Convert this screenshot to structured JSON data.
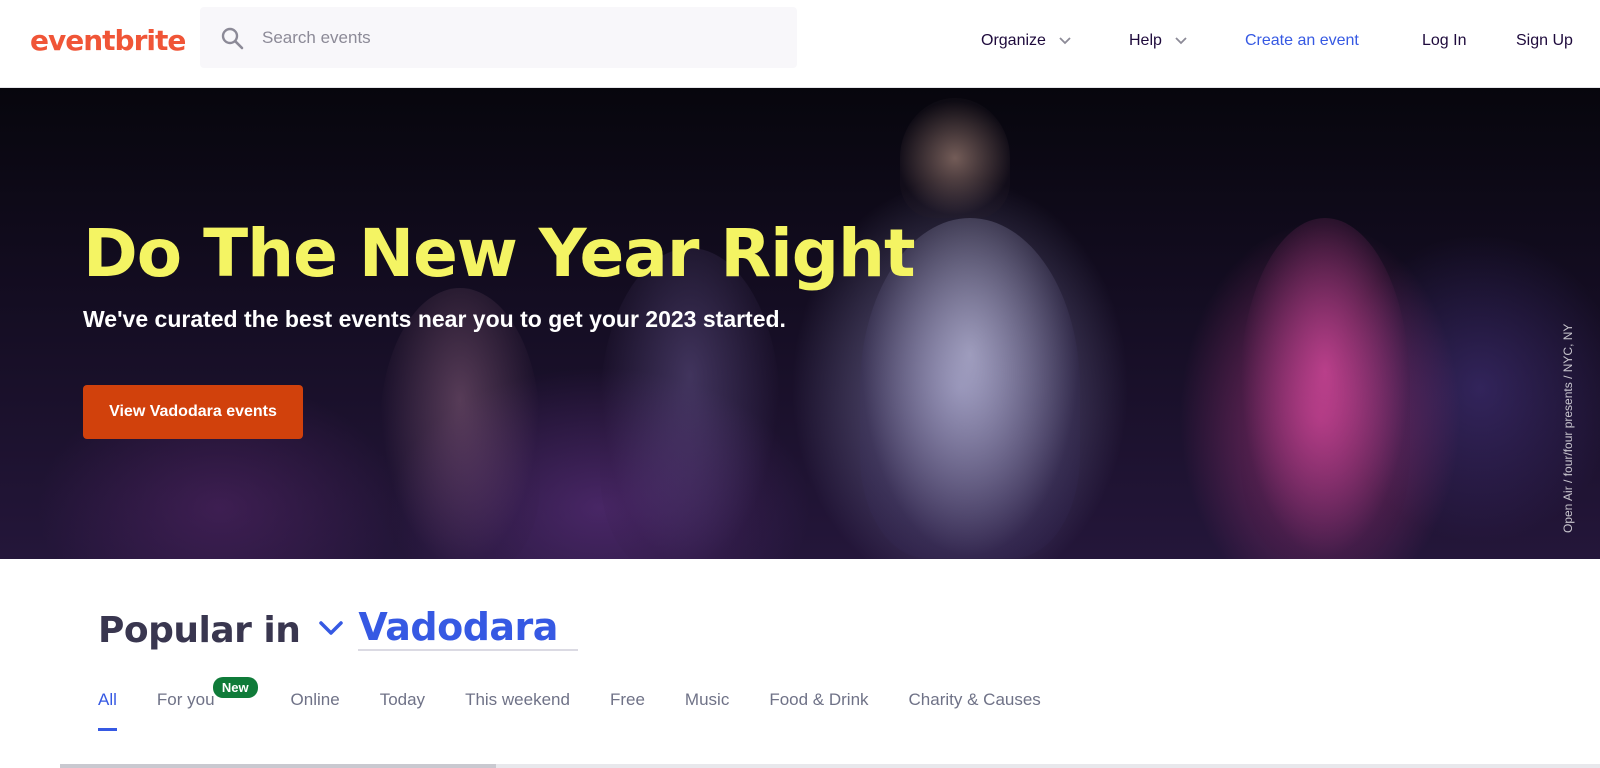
{
  "header": {
    "logo": "eventbrite",
    "search_placeholder": "Search events",
    "nav": {
      "organize": "Organize",
      "help": "Help",
      "create_event": "Create an event",
      "login": "Log In",
      "signup": "Sign Up"
    }
  },
  "hero": {
    "title": "Do The New Year Right",
    "subtitle": "We've curated the best events near you to get your 2023 started.",
    "cta": "View Vadodara events",
    "credit": "Open Air / four/four presents / NYC, NY"
  },
  "popular": {
    "label": "Popular in",
    "city": "Vadodara",
    "tabs": [
      {
        "label": "All",
        "active": true
      },
      {
        "label": "For you",
        "badge": "New"
      },
      {
        "label": "Online"
      },
      {
        "label": "Today"
      },
      {
        "label": "This weekend"
      },
      {
        "label": "Free"
      },
      {
        "label": "Music"
      },
      {
        "label": "Food & Drink"
      },
      {
        "label": "Charity & Causes"
      }
    ]
  },
  "colors": {
    "brand": "#f05537",
    "link": "#3659e3",
    "hero_title": "#f4f463",
    "cta": "#d1410c",
    "badge": "#0f7b39"
  }
}
